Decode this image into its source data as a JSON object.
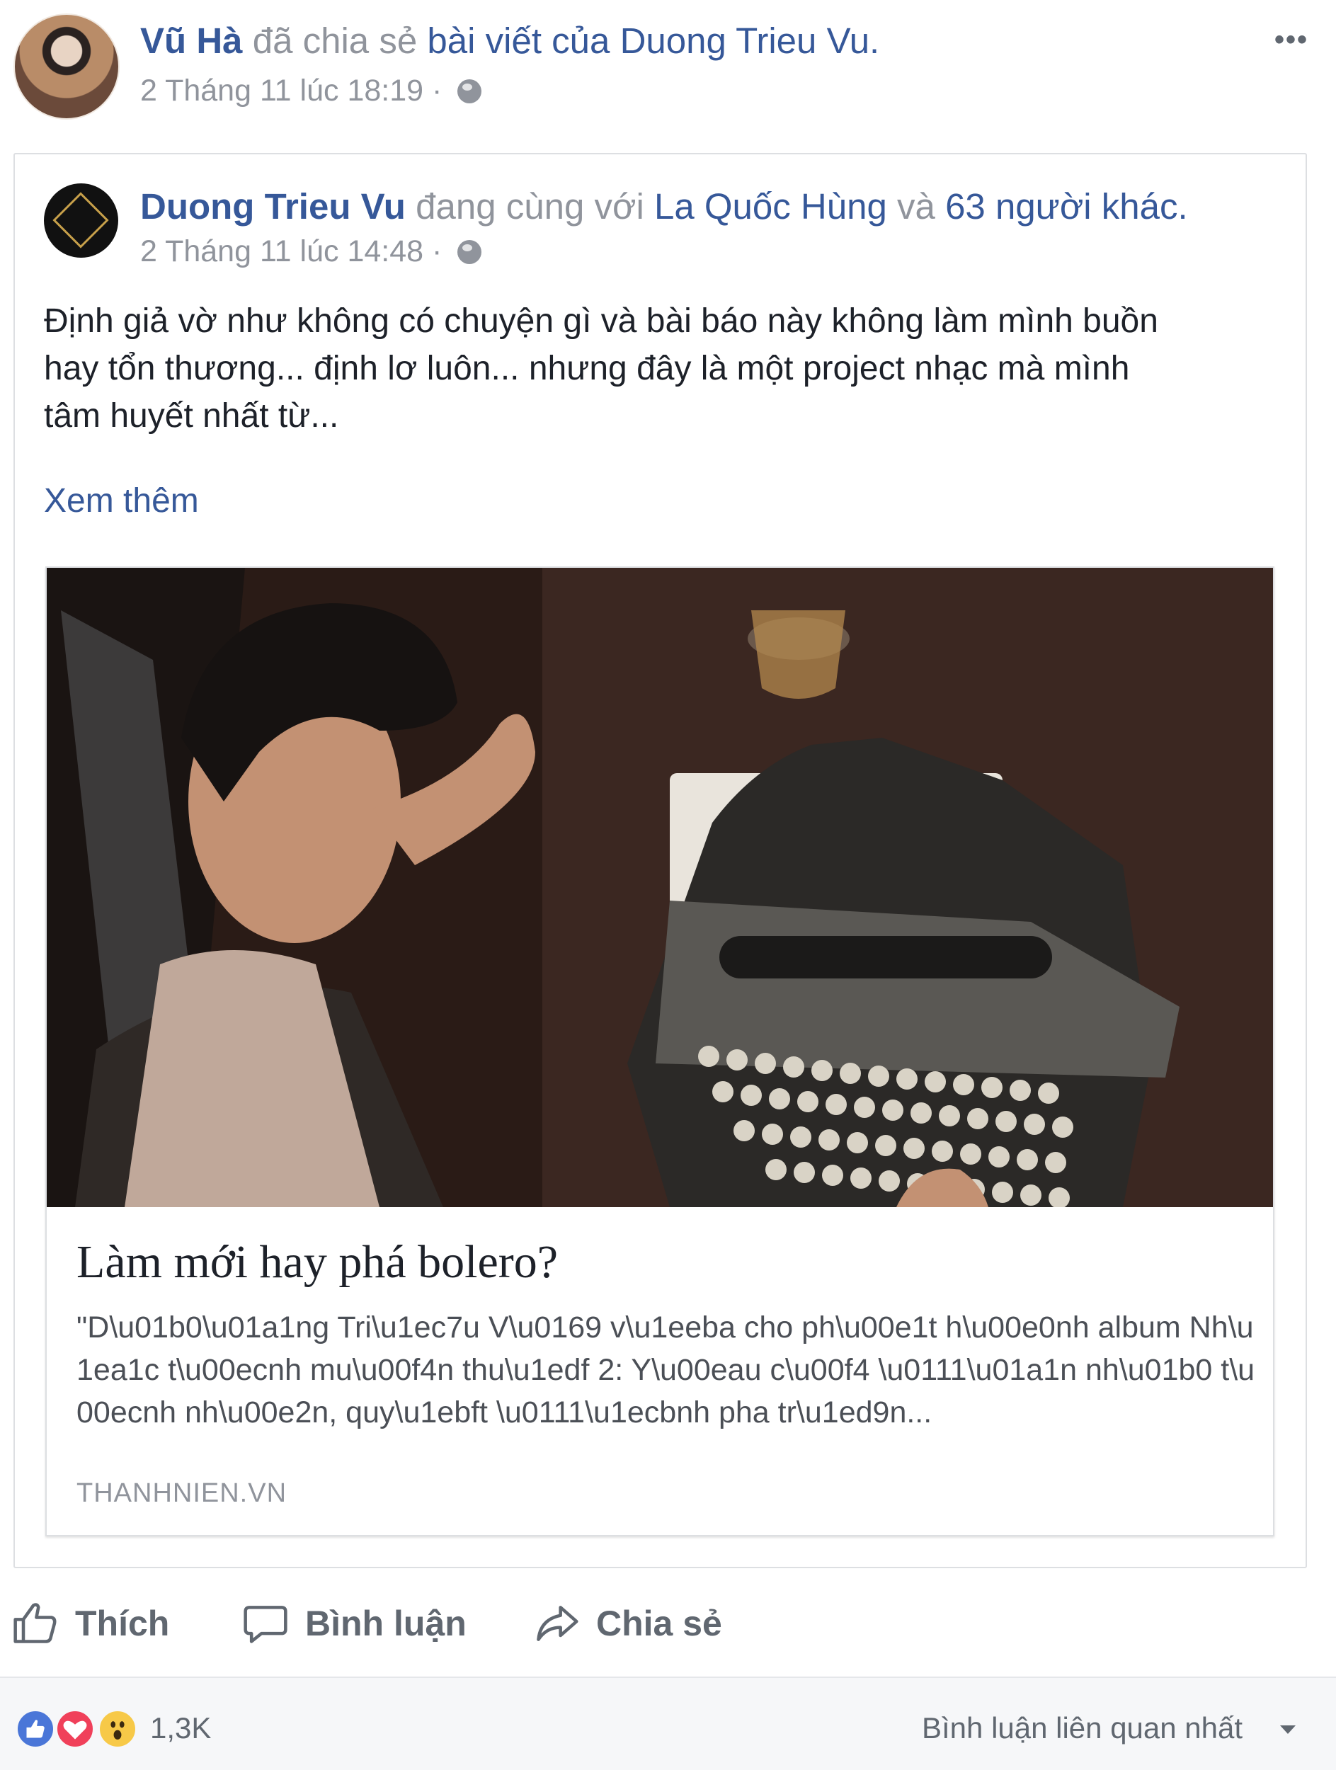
{
  "sharer": {
    "name": "Vũ Hà",
    "action_text": "đã chia sẻ",
    "object_text": "bài viết của",
    "original_author": "Duong Trieu Vu.",
    "timestamp": "2 Tháng 11 lúc 18:19",
    "separator": "·"
  },
  "post": {
    "author": "Duong Trieu Vu",
    "with_text": "đang cùng với",
    "tagged_person": "La Quốc Hùng",
    "and_text": "và",
    "others_text": "63 người khác.",
    "timestamp": "2 Tháng 11 lúc 14:48",
    "separator": "·",
    "body_lines": [
      "Định giả vờ như không có chuyện gì và bài báo này không làm mình buồn",
      "hay tổn thương... định lơ luôn... nhưng đây là một project nhạc mà mình",
      "tâm huyết nhất từ..."
    ],
    "see_more": "Xem thêm"
  },
  "link_preview": {
    "title": "Làm mới hay phá bolero?",
    "description": "\"D\\u01b0\\u01a1ng Tri\\u1ec7u V\\u0169 v\\u1eeba cho ph\\u00e1t h\\u00e0nh album Nh\\u1ea1c t\\u00ecnh mu\\u00f4n thu\\u1edf 2: Y\\u00eau c\\u00f4 \\u0111\\u01a1n nh\\u01b0 t\\u00ecnh nh\\u00e2n, quy\\u1ebft \\u0111\\u1ecbnh pha tr\\u1ed9n...",
    "domain": "THANHNIEN.VN"
  },
  "actions": {
    "like": "Thích",
    "comment": "Bình luận",
    "share": "Chia sẻ"
  },
  "footer": {
    "reaction_count": "1,3K",
    "sort_label": "Bình luận liên quan nhất"
  },
  "icons": [
    "globe-icon",
    "more-options-icon",
    "like-icon",
    "comment-icon",
    "share-icon",
    "reaction-like-icon",
    "reaction-love-icon",
    "reaction-wow-icon",
    "chevron-down-icon"
  ],
  "colors": {
    "link_blue": "#365899",
    "meta_gray": "#90949c",
    "action_gray": "#606770",
    "love_red": "#f0405a",
    "like_blue": "#4a76d8",
    "wow_yellow": "#f7c948"
  }
}
